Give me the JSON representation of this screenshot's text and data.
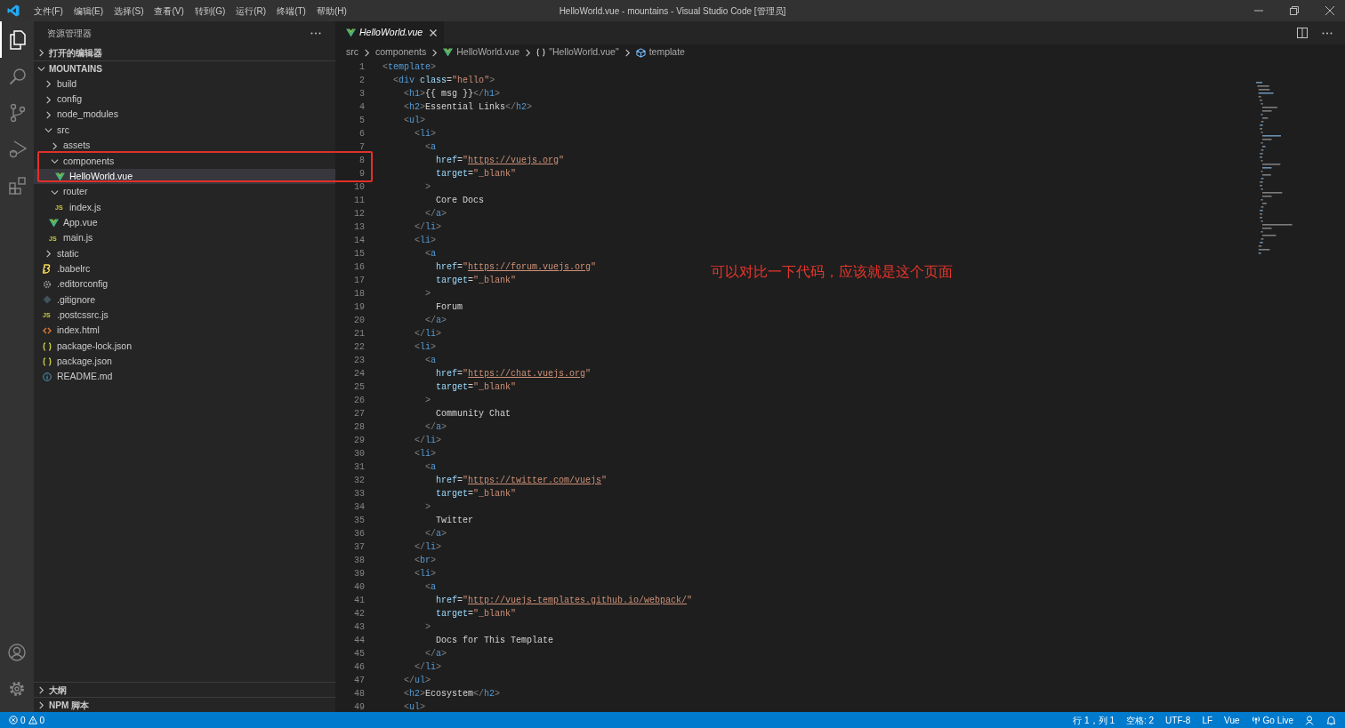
{
  "menu_bar": {
    "items": [
      "文件(F)",
      "编辑(E)",
      "选择(S)",
      "查看(V)",
      "转到(G)",
      "运行(R)",
      "终端(T)",
      "帮助(H)"
    ]
  },
  "window": {
    "title": "HelloWorld.vue - mountains - Visual Studio Code [管理员]"
  },
  "activity_bar": {
    "items": [
      {
        "kind": "explorer",
        "selected": true
      },
      {
        "kind": "search",
        "selected": false
      },
      {
        "kind": "source-control",
        "selected": false
      },
      {
        "kind": "run",
        "selected": false
      },
      {
        "kind": "extensions",
        "selected": false
      }
    ],
    "bottom": [
      {
        "kind": "account"
      },
      {
        "kind": "settings"
      }
    ]
  },
  "sidebar": {
    "title": "资源管理器",
    "sections": [
      {
        "label": "打开的编辑器",
        "expanded": false
      },
      {
        "label": "MOUNTAINS",
        "expanded": true
      }
    ],
    "tree": [
      {
        "label": "build",
        "kind": "folder",
        "expanded": false,
        "selected": false
      },
      {
        "label": "config",
        "kind": "folder",
        "expanded": false,
        "selected": false
      },
      {
        "label": "node_modules",
        "kind": "folder",
        "expanded": false,
        "selected": false
      },
      {
        "label": "src",
        "kind": "folder",
        "expanded": true,
        "selected": false,
        "children": [
          {
            "label": "assets",
            "kind": "folder",
            "expanded": false,
            "selected": false
          },
          {
            "label": "components",
            "kind": "folder",
            "expanded": true,
            "selected": false,
            "children": [
              {
                "label": "HelloWorld.vue",
                "kind": "vue",
                "selected": true
              }
            ]
          },
          {
            "label": "router",
            "kind": "folder",
            "expanded": true,
            "selected": false,
            "children": [
              {
                "label": "index.js",
                "kind": "js",
                "badge": "JS",
                "selected": false
              }
            ]
          },
          {
            "label": "App.vue",
            "kind": "vue",
            "selected": false
          },
          {
            "label": "main.js",
            "kind": "js",
            "badge": "JS",
            "selected": false
          }
        ]
      },
      {
        "label": "static",
        "kind": "folder",
        "expanded": false,
        "selected": false
      },
      {
        "label": ".babelrc",
        "kind": "babel",
        "selected": false
      },
      {
        "label": ".editorconfig",
        "kind": "gear",
        "selected": false
      },
      {
        "label": ".gitignore",
        "kind": "git",
        "selected": false
      },
      {
        "label": ".postcssrc.js",
        "kind": "js",
        "badge": "JS",
        "selected": false
      },
      {
        "label": "index.html",
        "kind": "html",
        "selected": false
      },
      {
        "label": "package-lock.json",
        "kind": "json",
        "selected": false
      },
      {
        "label": "package.json",
        "kind": "json",
        "selected": false
      },
      {
        "label": "README.md",
        "kind": "info",
        "selected": false
      }
    ],
    "bottom_sections": [
      {
        "label": "大纲",
        "expanded": false
      },
      {
        "label": "NPM 脚本",
        "expanded": false
      }
    ]
  },
  "editor": {
    "tabs": [
      {
        "label": "HelloWorld.vue",
        "kind": "vue",
        "selected": true,
        "preview": true
      }
    ],
    "breadcrumbs": [
      {
        "label": "src"
      },
      {
        "label": "components"
      },
      {
        "label": "HelloWorld.vue",
        "kind": "vue"
      },
      {
        "label": "\"HelloWorld.vue\"",
        "kind": "braces"
      },
      {
        "label": "template",
        "kind": "cube"
      }
    ],
    "lines": [
      {
        "number": "1",
        "code": "<template>"
      },
      {
        "number": "2",
        "code": "  <div class=\"hello\">"
      },
      {
        "number": "3",
        "code": "    <h1>{{ msg }}</h1>"
      },
      {
        "number": "4",
        "code": "    <h2>Essential Links</h2>"
      },
      {
        "number": "5",
        "code": "    <ul>"
      },
      {
        "number": "6",
        "code": "      <li>"
      },
      {
        "number": "7",
        "code": "        <a"
      },
      {
        "number": "8",
        "code": "          href=\"https://vuejs.org\""
      },
      {
        "number": "9",
        "code": "          target=\"_blank\""
      },
      {
        "number": "10",
        "code": "        >"
      },
      {
        "number": "11",
        "code": "          Core Docs"
      },
      {
        "number": "12",
        "code": "        </a>"
      },
      {
        "number": "13",
        "code": "      </li>"
      },
      {
        "number": "14",
        "code": "      <li>"
      },
      {
        "number": "15",
        "code": "        <a"
      },
      {
        "number": "16",
        "code": "          href=\"https://forum.vuejs.org\""
      },
      {
        "number": "17",
        "code": "          target=\"_blank\""
      },
      {
        "number": "18",
        "code": "        >"
      },
      {
        "number": "19",
        "code": "          Forum"
      },
      {
        "number": "20",
        "code": "        </a>"
      },
      {
        "number": "21",
        "code": "      </li>"
      },
      {
        "number": "22",
        "code": "      <li>"
      },
      {
        "number": "23",
        "code": "        <a"
      },
      {
        "number": "24",
        "code": "          href=\"https://chat.vuejs.org\""
      },
      {
        "number": "25",
        "code": "          target=\"_blank\""
      },
      {
        "number": "26",
        "code": "        >"
      },
      {
        "number": "27",
        "code": "          Community Chat"
      },
      {
        "number": "28",
        "code": "        </a>"
      },
      {
        "number": "29",
        "code": "      </li>"
      },
      {
        "number": "30",
        "code": "      <li>"
      },
      {
        "number": "31",
        "code": "        <a"
      },
      {
        "number": "32",
        "code": "          href=\"https://twitter.com/vuejs\""
      },
      {
        "number": "33",
        "code": "          target=\"_blank\""
      },
      {
        "number": "34",
        "code": "        >"
      },
      {
        "number": "35",
        "code": "          Twitter"
      },
      {
        "number": "36",
        "code": "        </a>"
      },
      {
        "number": "37",
        "code": "      </li>"
      },
      {
        "number": "38",
        "code": "      <br>"
      },
      {
        "number": "39",
        "code": "      <li>"
      },
      {
        "number": "40",
        "code": "        <a"
      },
      {
        "number": "41",
        "code": "          href=\"http://vuejs-templates.github.io/webpack/\""
      },
      {
        "number": "42",
        "code": "          target=\"_blank\""
      },
      {
        "number": "43",
        "code": "        >"
      },
      {
        "number": "44",
        "code": "          Docs for This Template"
      },
      {
        "number": "45",
        "code": "        </a>"
      },
      {
        "number": "46",
        "code": "      </li>"
      },
      {
        "number": "47",
        "code": "    </ul>"
      },
      {
        "number": "48",
        "code": "    <h2>Ecosystem</h2>"
      },
      {
        "number": "49",
        "code": "    <ul>"
      }
    ],
    "annotation": "可以对比一下代码，应该就是这个页面"
  },
  "status_bar": {
    "errors": "0",
    "warnings": "0",
    "items": [
      {
        "label": "行 1，列 1"
      },
      {
        "label": "空格: 2"
      },
      {
        "label": "UTF-8"
      },
      {
        "label": "LF"
      },
      {
        "label": "Vue"
      },
      {
        "label": "Go Live",
        "kind": "live"
      }
    ]
  }
}
